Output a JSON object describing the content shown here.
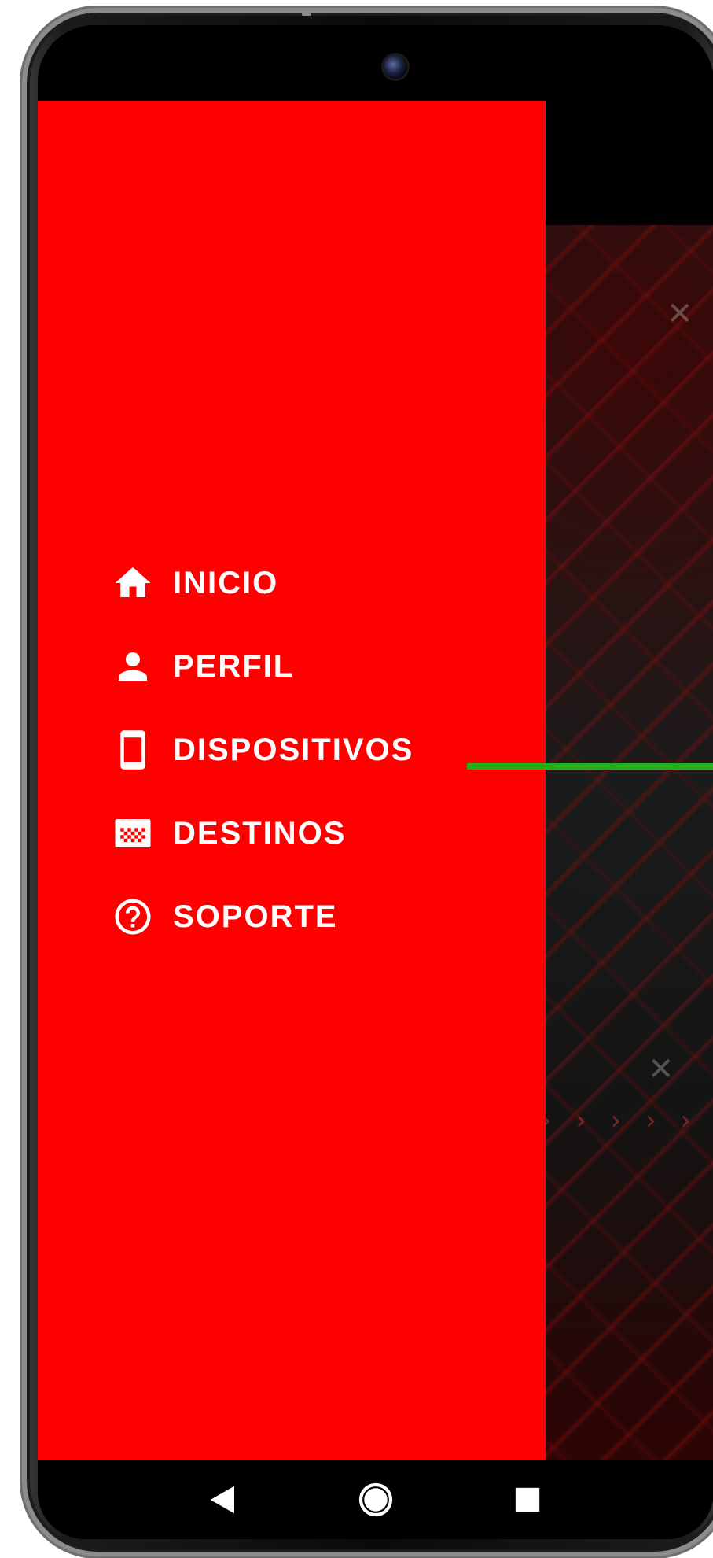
{
  "colors": {
    "drawer_background": "#ff0000",
    "drawer_text": "#ffffff",
    "indicator_line": "#22b016",
    "nav_bar": "#000000"
  },
  "drawer": {
    "items": [
      {
        "label": "INICIO",
        "icon": "home-icon"
      },
      {
        "label": "PERFIL",
        "icon": "person-icon"
      },
      {
        "label": "DISPOSITIVOS",
        "icon": "smartphone-icon"
      },
      {
        "label": "DESTINOS",
        "icon": "destination-flag-icon"
      },
      {
        "label": "SOPORTE",
        "icon": "help-circle-icon"
      }
    ]
  },
  "system_nav": {
    "back": "back-triangle-icon",
    "home": "home-circle-icon",
    "recents": "recents-square-icon"
  }
}
